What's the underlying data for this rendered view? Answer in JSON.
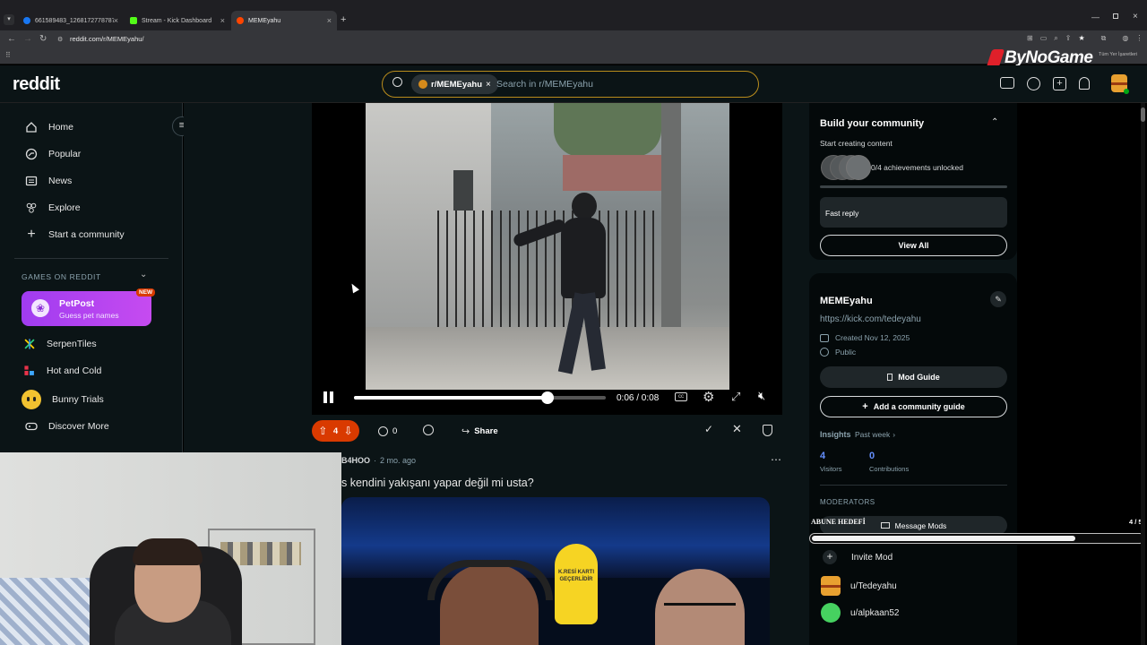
{
  "browser": {
    "tabs": [
      {
        "label": "661589483_1268172778787213..."
      },
      {
        "label": "Stream - Kick Dashboard"
      },
      {
        "label": "MEMEyahu"
      }
    ],
    "url": "reddit.com/r/MEMEyahu/",
    "bookmarks_label": "Tüm Yer İşaretleri"
  },
  "overlay": {
    "brand": "ByNoGame",
    "goal_label": "ABUNE HEDEFİ",
    "goal_count": "4 / 5",
    "goal_progress": 0.8
  },
  "header": {
    "logo": "reddit",
    "search_chip": "r/MEMEyahu",
    "search_placeholder": "Search in r/MEMEyahu"
  },
  "sidebar": {
    "items": [
      {
        "label": "Home",
        "icon": "home-icon"
      },
      {
        "label": "Popular",
        "icon": "popular-icon"
      },
      {
        "label": "News",
        "icon": "news-icon"
      },
      {
        "label": "Explore",
        "icon": "explore-icon"
      },
      {
        "label": "Start a community",
        "icon": "plus-icon"
      }
    ],
    "games_heading": "GAMES ON REDDIT",
    "petpost": {
      "title": "PetPost",
      "subtitle": "Guess pet names",
      "badge": "NEW"
    },
    "games": [
      {
        "label": "SerpenTiles"
      },
      {
        "label": "Hot and Cold"
      },
      {
        "label": "Bunny Trials"
      },
      {
        "label": "Discover More"
      }
    ]
  },
  "post1": {
    "time": "0:06 / 0:08",
    "progress": 0.77,
    "votes": "4",
    "comments": "0",
    "share": "Share"
  },
  "post2": {
    "author": "B4HOO",
    "age": "2 mo. ago",
    "title": "s kendini yakışanı yapar değil mi usta?",
    "sign_text": "K.RESİ KARTI GEÇERLİDİR"
  },
  "right": {
    "build": {
      "title": "Build your community",
      "subtitle": "Start creating content",
      "achievements": "0/4 achievements unlocked",
      "fast_reply": "Fast reply",
      "view_all": "View All"
    },
    "about": {
      "name": "MEMEyahu",
      "link": "https://kick.com/tedeyahu",
      "created": "Created Nov 12, 2025",
      "visibility": "Public",
      "mod_guide": "Mod Guide",
      "add_guide": "Add a community guide",
      "insights": "Insights",
      "insights_period": "Past week",
      "visitors_value": "4",
      "visitors_label": "Visitors",
      "contrib_value": "0",
      "contrib_label": "Contributions"
    },
    "moderators": {
      "heading": "MODERATORS",
      "message_mods": "Message Mods",
      "invite": "Invite Mod",
      "users": [
        "u/Tedeyahu",
        "u/alpkaan52"
      ]
    }
  },
  "colors": {
    "accent_orange": "#d93a00",
    "link_blue": "#648efc",
    "header_bg": "#0b1416"
  }
}
